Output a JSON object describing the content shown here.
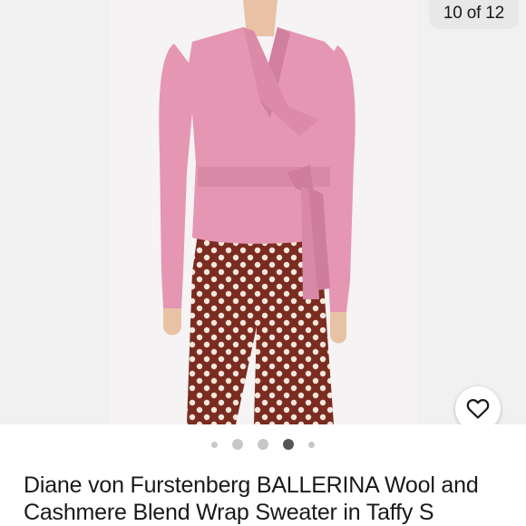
{
  "gallery": {
    "counter_text": "10 of 12",
    "current_index": 10,
    "total": 12,
    "image_alt": "Model wearing pink wrap sweater with polka-dot trousers",
    "favorite_icon": "heart-outline-icon"
  },
  "carousel": {
    "dot_count": 5,
    "active_dot": 3
  },
  "product": {
    "title": "Diane von Furstenberg BALLERINA Wool and Cashmere Blend Wrap Sweater in Taffy S"
  },
  "colors": {
    "sweater": "#e596b3",
    "trousers": "#7a2c20",
    "dot_active": "#555555",
    "dot_inactive": "#c7c7c7"
  }
}
